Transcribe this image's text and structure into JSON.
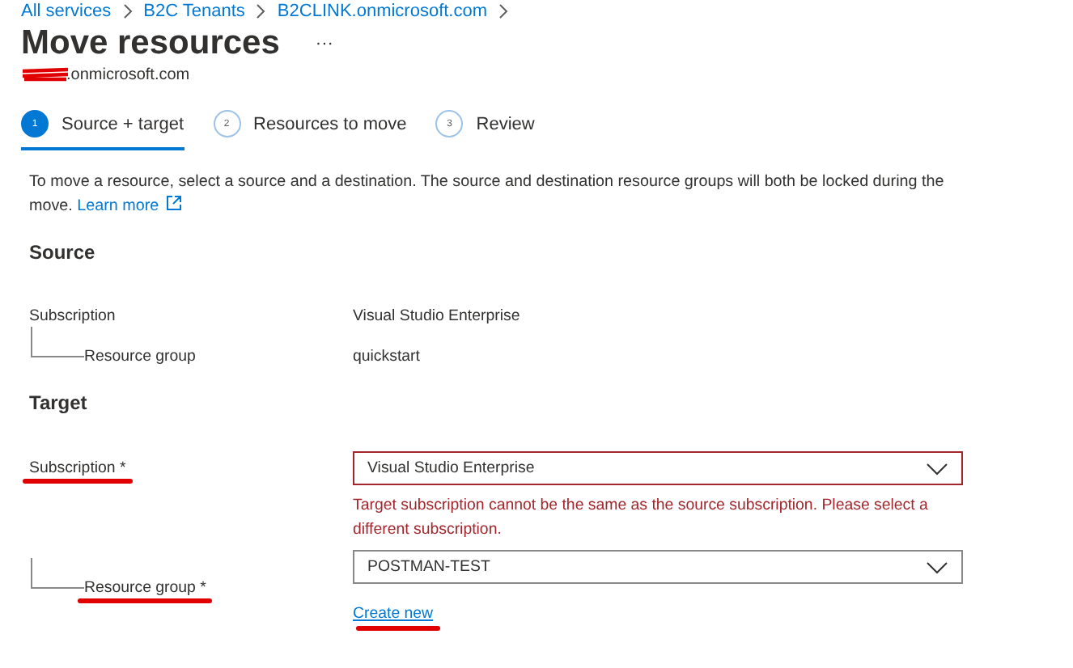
{
  "breadcrumb": [
    "All services",
    "B2C Tenants",
    "B2CLINK.onmicrosoft.com"
  ],
  "page": {
    "title": "Move resources",
    "more": "···",
    "subtitle": ".onmicrosoft.com",
    "subtitle_redacted": true
  },
  "steps": [
    {
      "number": "1",
      "label": "Source + target",
      "selected": true
    },
    {
      "number": "2",
      "label": "Resources to move",
      "selected": false
    },
    {
      "number": "3",
      "label": "Review",
      "selected": false
    }
  ],
  "description": {
    "text": "To move a resource, select a source and a destination. The source and destination resource groups will both be locked during the move.",
    "link": "Learn more"
  },
  "source": {
    "heading": "Source",
    "rows": [
      {
        "label": "Subscription",
        "value": "Visual Studio Enterprise",
        "children": [
          {
            "label": "Resource group",
            "value": "quickstart"
          }
        ]
      }
    ]
  },
  "target": {
    "heading": "Target",
    "fields": [
      {
        "label": "Subscription",
        "required": "*",
        "value": "Visual Studio Enterprise",
        "invalid": true,
        "error": "Target subscription cannot be the same as the source subscription. Please select a different subscription.",
        "annotated": true,
        "children": [
          {
            "label": "Resource group",
            "required": "*",
            "value": "POSTMAN-TEST",
            "invalid": false,
            "link": "Create new",
            "annotated": true
          }
        ]
      }
    ]
  }
}
